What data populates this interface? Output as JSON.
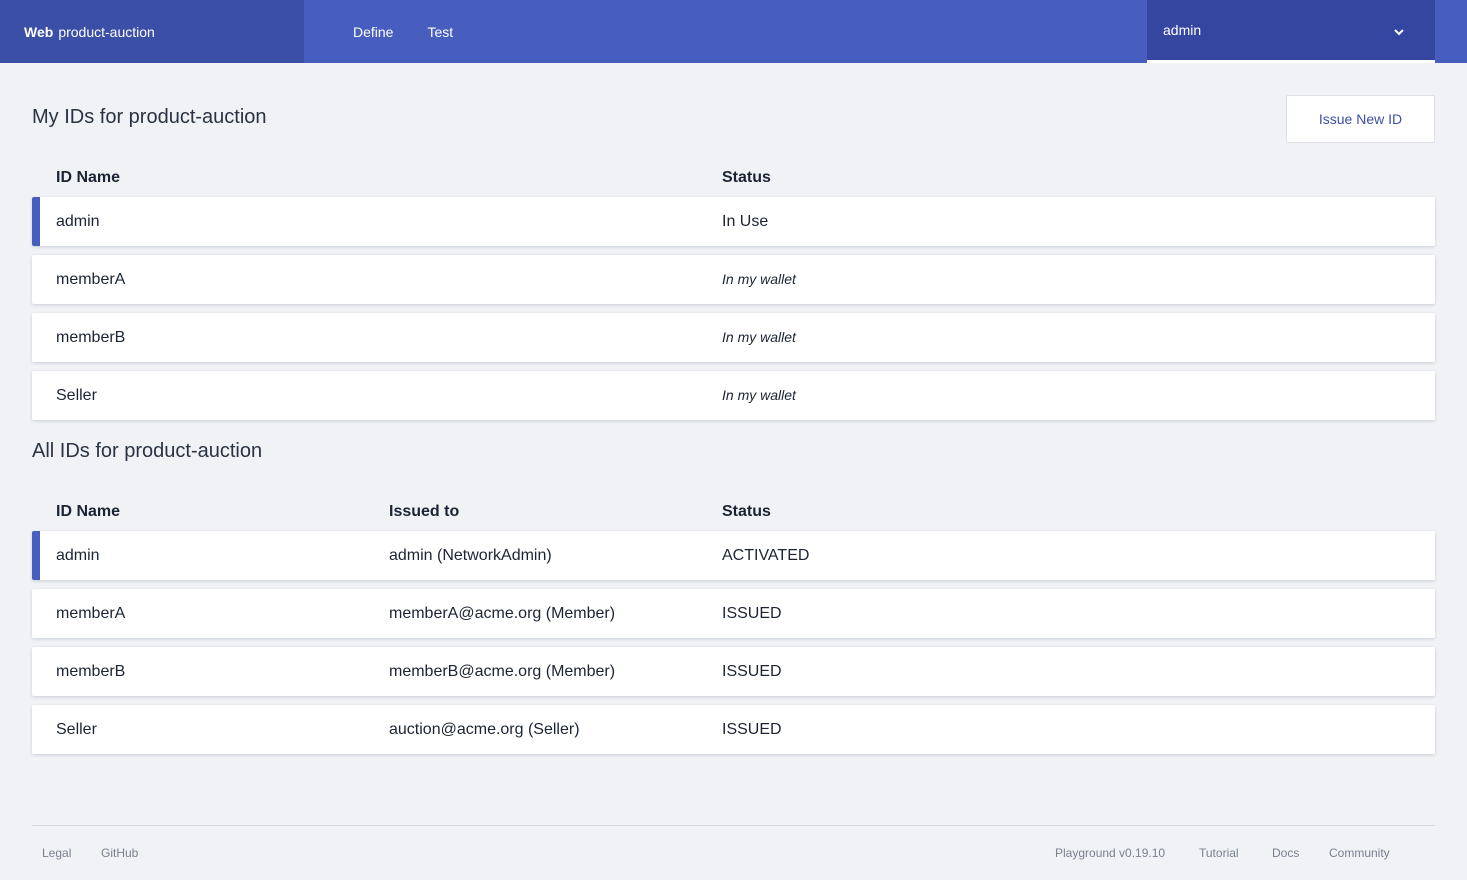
{
  "header": {
    "brand_strong": "Web",
    "brand_name": "product-auction",
    "nav": [
      "Define",
      "Test"
    ],
    "user": "admin"
  },
  "my_ids": {
    "title": "My IDs for product-auction",
    "issue_button": "Issue New ID",
    "columns": [
      "ID Name",
      "Status"
    ],
    "rows": [
      {
        "name": "admin",
        "status": "In Use"
      },
      {
        "name": "memberA",
        "status": "In my wallet"
      },
      {
        "name": "memberB",
        "status": "In my wallet"
      },
      {
        "name": "Seller",
        "status": "In my wallet"
      }
    ]
  },
  "all_ids": {
    "title": "All IDs for product-auction",
    "columns": [
      "ID Name",
      "Issued to",
      "Status"
    ],
    "rows": [
      {
        "name": "admin",
        "issued_to": "admin (NetworkAdmin)",
        "status": "ACTIVATED"
      },
      {
        "name": "memberA",
        "issued_to": "memberA@acme.org (Member)",
        "status": "ISSUED"
      },
      {
        "name": "memberB",
        "issued_to": "memberB@acme.org (Member)",
        "status": "ISSUED"
      },
      {
        "name": "Seller",
        "issued_to": "auction@acme.org (Seller)",
        "status": "ISSUED"
      }
    ]
  },
  "footer": {
    "left": [
      "Legal",
      "GitHub"
    ],
    "right": [
      "Playground v0.19.10",
      "Tutorial",
      "Docs",
      "Community"
    ]
  }
}
